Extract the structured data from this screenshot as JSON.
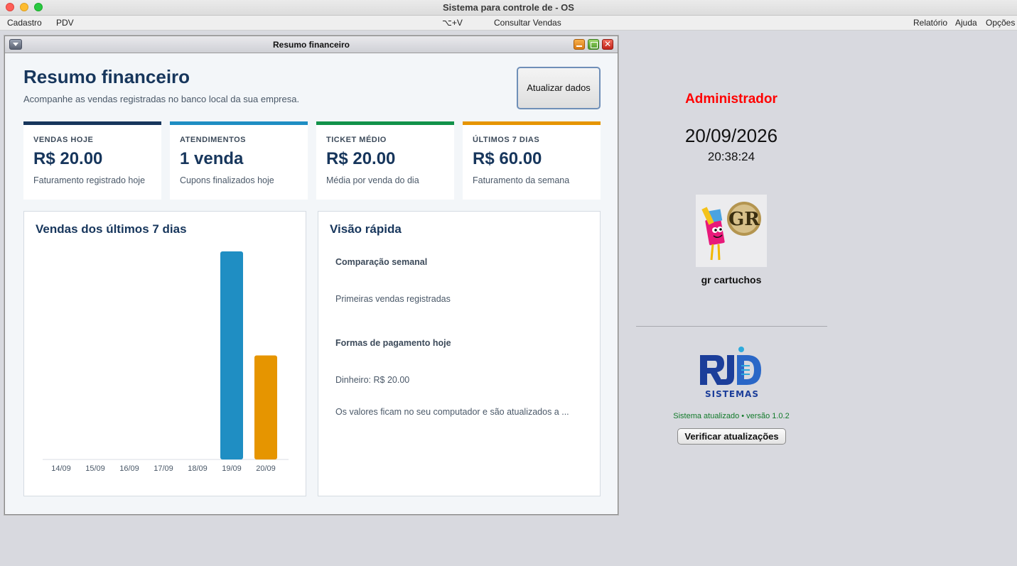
{
  "window": {
    "title": "Sistema para controle de - OS"
  },
  "menubar": {
    "left": [
      "Cadastro",
      "PDV"
    ],
    "center": [
      "⌥+V",
      "Consultar Vendas"
    ],
    "right": [
      "Relatório",
      "Ajuda",
      "Opções"
    ]
  },
  "frame": {
    "title": "Resumo financeiro"
  },
  "header": {
    "title": "Resumo financeiro",
    "subtitle": "Acompanhe as vendas registradas no banco local da sua empresa.",
    "refresh_label": "Atualizar dados"
  },
  "cards": [
    {
      "label": "VENDAS HOJE",
      "value": "R$ 20.00",
      "desc": "Faturamento registrado hoje",
      "color": "#17365c"
    },
    {
      "label": "ATENDIMENTOS",
      "value": "1 venda",
      "desc": "Cupons finalizados hoje",
      "color": "#1f8ec3"
    },
    {
      "label": "TICKET MÉDIO",
      "value": "R$ 20.00",
      "desc": "Média por venda do dia",
      "color": "#12924a"
    },
    {
      "label": "ÚLTIMOS 7 DIAS",
      "value": "R$ 60.00",
      "desc": "Faturamento da semana",
      "color": "#e69500"
    }
  ],
  "chart_panel": {
    "title": "Vendas dos últimos 7 dias"
  },
  "chart_data": {
    "type": "bar",
    "categories": [
      "14/09",
      "15/09",
      "16/09",
      "17/09",
      "18/09",
      "19/09",
      "20/09"
    ],
    "values": [
      0,
      0,
      0,
      0,
      0,
      40,
      20
    ],
    "colors": [
      "#1f8ec3",
      "#1f8ec3",
      "#1f8ec3",
      "#1f8ec3",
      "#1f8ec3",
      "#1f8ec3",
      "#e69500"
    ],
    "ylim": [
      0,
      40
    ],
    "grid": false
  },
  "quick_view": {
    "title": "Visão rápida",
    "weekly_label": "Comparação semanal",
    "weekly_text": "Primeiras vendas registradas",
    "payments_label": "Formas de pagamento hoje",
    "payments_text": "Dinheiro: R$ 20.00",
    "note": "Os valores ficam no seu computador e são atualizados a ..."
  },
  "side": {
    "user": "Administrador",
    "date": "20/09/2026",
    "time": "20:38:24",
    "company": "gr cartuchos",
    "company_logo_text": "GR",
    "vendor_logo_text": "SISTEMAS",
    "update_status": "Sistema atualizado • versão 1.0.2",
    "update_button": "Verificar atualizações"
  }
}
